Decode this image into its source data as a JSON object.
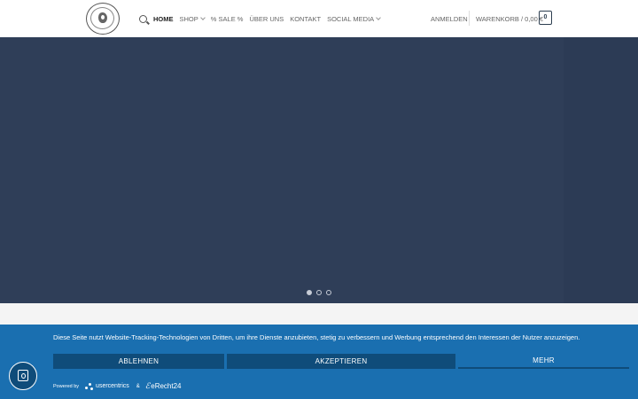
{
  "header": {
    "nav": [
      {
        "label": "HOME",
        "active": true,
        "dropdown": false
      },
      {
        "label": "SHOP",
        "active": false,
        "dropdown": true
      },
      {
        "label": "% SALE %",
        "active": false,
        "dropdown": false
      },
      {
        "label": "ÜBER UNS",
        "active": false,
        "dropdown": false
      },
      {
        "label": "KONTAKT",
        "active": false,
        "dropdown": false
      },
      {
        "label": "SOCIAL MEDIA",
        "active": false,
        "dropdown": true
      }
    ],
    "login_label": "ANMELDEN",
    "cart_label": "WARENKORB / 0,00 €",
    "cart_count": "0",
    "icons": {
      "search": "search-icon",
      "dropdown": "chevron-down-icon"
    }
  },
  "hero": {
    "slide_count": 3,
    "active_slide": 1,
    "colors": {
      "background": "#2f3e58",
      "dot": "#c7ccd6"
    }
  },
  "cookie_banner": {
    "text": "Diese Seite nutzt Website-Tracking-Technologien von Dritten, um ihre Dienste anzubieten, stetig zu verbessern und Werbung entsprechend den Interessen der Nutzer anzuzeigen.",
    "deny_label": "ABLEHNEN",
    "accept_label": "AKZEPTIEREN",
    "more_label": "MEHR",
    "powered_by": "Powered by",
    "brand_usercentrics": "usercentrics",
    "ampersand": "&",
    "brand_erecht": "eRecht24",
    "colors": {
      "banner": "#1a6fb0",
      "button": "#0f4c7a"
    }
  },
  "privacy_widget": {
    "icon": "fingerprint-icon"
  }
}
